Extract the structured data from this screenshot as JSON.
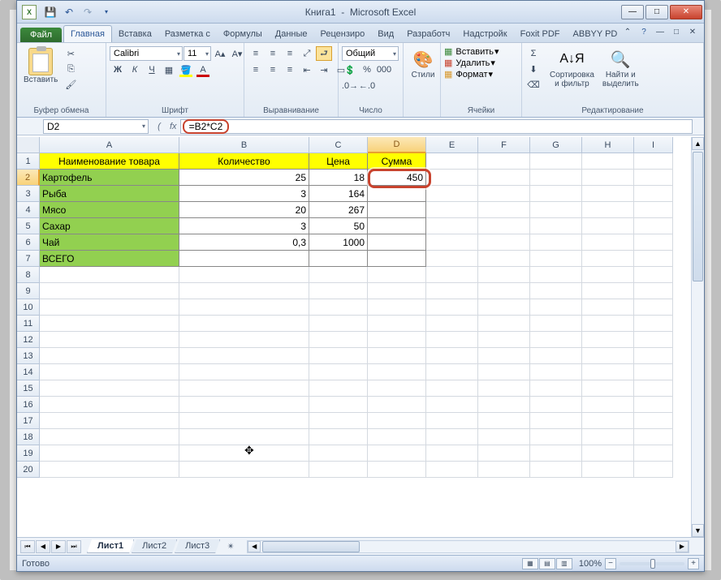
{
  "title": {
    "document": "Книга1",
    "appname": "Microsoft Excel"
  },
  "qat": {
    "save": "💾",
    "undo": "↶",
    "redo": "↷"
  },
  "tabs": {
    "file": "Файл",
    "items": [
      "Главная",
      "Вставка",
      "Разметка с",
      "Формулы",
      "Данные",
      "Рецензиро",
      "Вид",
      "Разработч",
      "Надстройк",
      "Foxit PDF",
      "ABBYY PD"
    ]
  },
  "ribbon": {
    "clipboard": {
      "paste": "Вставить",
      "label": "Буфер обмена"
    },
    "font": {
      "name": "Calibri",
      "size": "11",
      "label": "Шрифт"
    },
    "align": {
      "label": "Выравнивание"
    },
    "number": {
      "format": "Общий",
      "label": "Число"
    },
    "styles": {
      "btn": "Стили",
      "label": ""
    },
    "cells": {
      "insert": "Вставить",
      "delete": "Удалить",
      "format": "Формат",
      "label": "Ячейки"
    },
    "editing": {
      "sort": "Сортировка\nи фильтр",
      "find": "Найти и\nвыделить",
      "label": "Редактирование"
    }
  },
  "fbar": {
    "namebox": "D2",
    "formula": "=B2*C2"
  },
  "cols": [
    "A",
    "B",
    "C",
    "D",
    "E",
    "F",
    "G",
    "H",
    "I"
  ],
  "active_col": "D",
  "active_row": 2,
  "headers": {
    "a": "Наименование товара",
    "b": "Количество",
    "c": "Цена",
    "d": "Сумма"
  },
  "rows": [
    {
      "a": "Картофель",
      "b": "25",
      "c": "18",
      "d": "450"
    },
    {
      "a": "Рыба",
      "b": "3",
      "c": "164",
      "d": ""
    },
    {
      "a": "Мясо",
      "b": "20",
      "c": "267",
      "d": ""
    },
    {
      "a": "Сахар",
      "b": "3",
      "c": "50",
      "d": ""
    },
    {
      "a": "Чай",
      "b": "0,3",
      "c": "1000",
      "d": ""
    }
  ],
  "total_label": "ВСЕГО",
  "sheets": {
    "items": [
      "Лист1",
      "Лист2",
      "Лист3"
    ],
    "active": 0
  },
  "status": {
    "ready": "Готово",
    "zoom": "100%"
  },
  "chart_data": {
    "type": "table",
    "columns": [
      "Наименование товара",
      "Количество",
      "Цена",
      "Сумма"
    ],
    "rows": [
      [
        "Картофель",
        25,
        18,
        450
      ],
      [
        "Рыба",
        3,
        164,
        null
      ],
      [
        "Мясо",
        20,
        267,
        null
      ],
      [
        "Сахар",
        3,
        50,
        null
      ],
      [
        "Чай",
        0.3,
        1000,
        null
      ],
      [
        "ВСЕГО",
        null,
        null,
        null
      ]
    ],
    "formula_D2": "=B2*C2"
  }
}
